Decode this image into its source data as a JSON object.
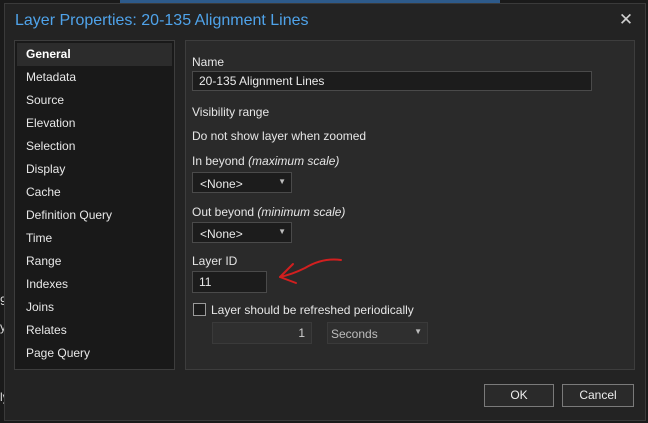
{
  "dialog": {
    "title": "Layer Properties: 20-135 Alignment Lines",
    "close_glyph": "✕"
  },
  "nav": {
    "items": [
      {
        "label": "General",
        "active": true
      },
      {
        "label": "Metadata"
      },
      {
        "label": "Source"
      },
      {
        "label": "Elevation"
      },
      {
        "label": "Selection"
      },
      {
        "label": "Display"
      },
      {
        "label": "Cache"
      },
      {
        "label": "Definition Query"
      },
      {
        "label": "Time"
      },
      {
        "label": "Range"
      },
      {
        "label": "Indexes"
      },
      {
        "label": "Joins"
      },
      {
        "label": "Relates"
      },
      {
        "label": "Page Query"
      }
    ]
  },
  "general": {
    "name_label": "Name",
    "name_value": "20-135 Alignment Lines",
    "visibility_label": "Visibility range",
    "dont_show_label": "Do not show layer when zoomed",
    "in_beyond_label": "In beyond",
    "in_beyond_hint": "(maximum scale)",
    "in_beyond_value": "<None>",
    "out_beyond_label": "Out beyond",
    "out_beyond_hint": "(minimum scale)",
    "out_beyond_value": "<None>",
    "layer_id_label": "Layer ID",
    "layer_id_value": "11",
    "refresh_label": "Layer should be refreshed periodically",
    "refresh_checked": false,
    "refresh_interval_value": "1",
    "refresh_unit_value": "Seconds"
  },
  "footer": {
    "ok_label": "OK",
    "cancel_label": "Cancel"
  },
  "colors": {
    "title_accent": "#4fa3ea",
    "annotation_red": "#d21f1f"
  },
  "background": {
    "glyphs": [
      "9",
      "y",
      "ly"
    ]
  }
}
